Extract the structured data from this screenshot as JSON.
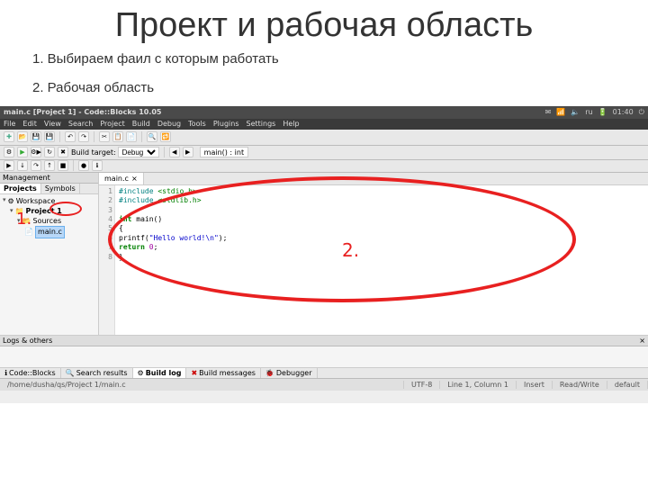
{
  "slide": {
    "title": "Проект и рабочая область",
    "point1": "1. Выбираем фаил с которым работать",
    "point2": "2. Рабочая область"
  },
  "annotations": {
    "label1": "1.",
    "label2": "2."
  },
  "titlebar": {
    "text": "main.c [Project 1] - Code::Blocks 10.05",
    "lang": "ru",
    "time": "01:40"
  },
  "menubar": {
    "items": [
      "File",
      "Edit",
      "View",
      "Search",
      "Project",
      "Build",
      "Debug",
      "Tools",
      "Plugins",
      "Settings",
      "Help"
    ]
  },
  "toolbar2": {
    "build_target_label": "Build target:",
    "build_target_value": "Debug",
    "func_nav": "main() : int"
  },
  "sidebar": {
    "title": "Management",
    "tabs": {
      "projects": "Projects",
      "symbols": "Symbols"
    },
    "tree": {
      "workspace": "Workspace",
      "project": "Project 1",
      "sources": "Sources",
      "file": "main.c"
    }
  },
  "editor": {
    "tab": "main.c",
    "lines": [
      "1",
      "2",
      "3",
      "4",
      "5",
      "6",
      "7",
      "8"
    ],
    "code": {
      "l1a": "#include ",
      "l1b": "<stdio.h>",
      "l2a": "#include ",
      "l2b": "<stdlib.h>",
      "l4a": "int",
      "l4b": " main()",
      "l5": "{",
      "l6a": "    printf(",
      "l6b": "\"Hello world!\\n\"",
      "l6c": ");",
      "l7a": "    ",
      "l7b": "return",
      "l7c": " ",
      "l7d": "0",
      "l7e": ";",
      "l8": "}"
    }
  },
  "bottom": {
    "title": "Logs & others",
    "tabs": {
      "codeblocks": "Code::Blocks",
      "search": "Search results",
      "buildlog": "Build log",
      "buildmsg": "Build messages",
      "debugger": "Debugger"
    }
  },
  "statusbar": {
    "path": "/home/dusha/qs/Project 1/main.c",
    "encoding": "UTF-8",
    "cursor": "Line 1, Column 1",
    "insert": "Insert",
    "rw": "Read/Write",
    "profile": "default"
  }
}
